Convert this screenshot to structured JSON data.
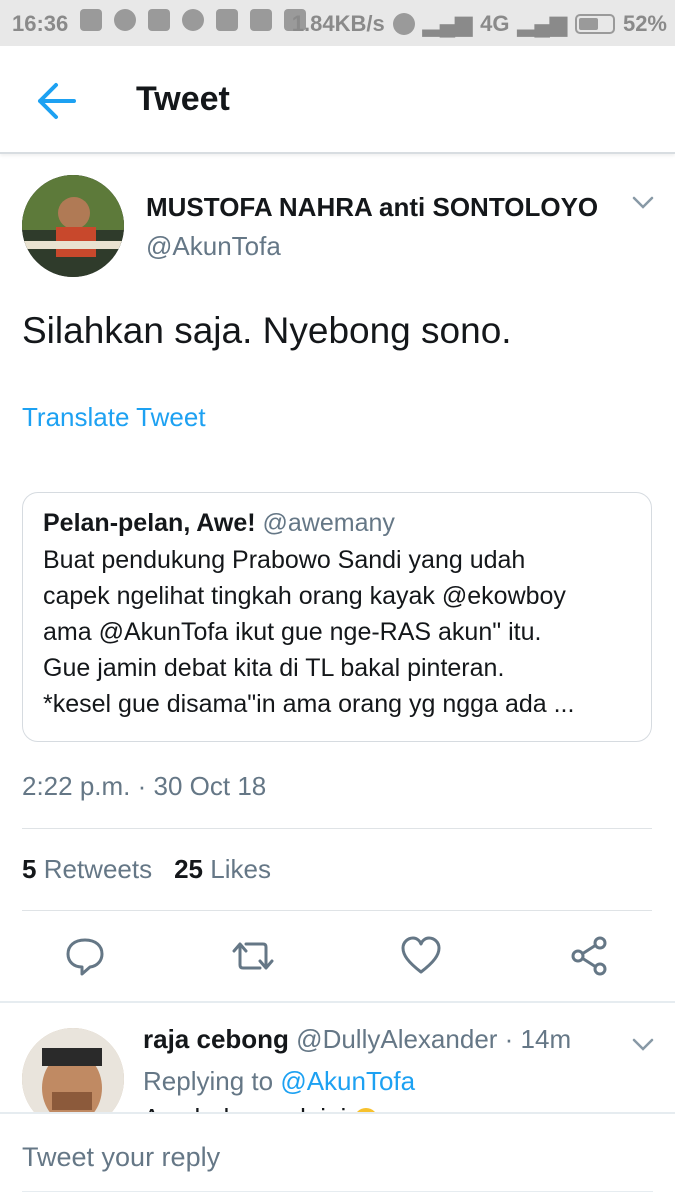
{
  "status_bar": {
    "time": "16:36",
    "speed": "1.84KB/s",
    "network": "4G",
    "battery": "52%"
  },
  "app_bar": {
    "title": "Tweet"
  },
  "tweet": {
    "author_name": "MUSTOFA NAHRA anti SONTOLOYO",
    "author_handle": "@AkunTofa",
    "text": "Silahkan saja. Nyebong sono.",
    "translate_label": "Translate Tweet",
    "timestamp": "2:22 p.m. · 30 Oct 18",
    "retweets_count": "5",
    "retweets_label": "Retweets",
    "likes_count": "25",
    "likes_label": "Likes"
  },
  "quote": {
    "name": "Pelan-pelan, Awe!",
    "handle": "@awemany",
    "lines": [
      "Buat pendukung Prabowo Sandi yang udah",
      "capek ngelihat tingkah orang kayak @ekowboy",
      "ama @AkunTofa ikut gue nge-RAS akun\" itu.",
      "Gue jamin debat kita di TL bakal pinteran.",
      "*kesel gue disama\"in ama orang yg ngga ada ..."
    ]
  },
  "reply": {
    "name": "raja cebong",
    "handle": "@DullyAlexander",
    "time": "· 14m",
    "replying_prefix": "Replying to",
    "replying_to": "@AkunTofa",
    "text_cut": "Ayo bahas yuk ini"
  },
  "compose": {
    "placeholder": "Tweet your reply"
  },
  "colors": {
    "accent": "#1da1f2",
    "secondary_text": "#657786",
    "primary_text": "#14171a"
  }
}
